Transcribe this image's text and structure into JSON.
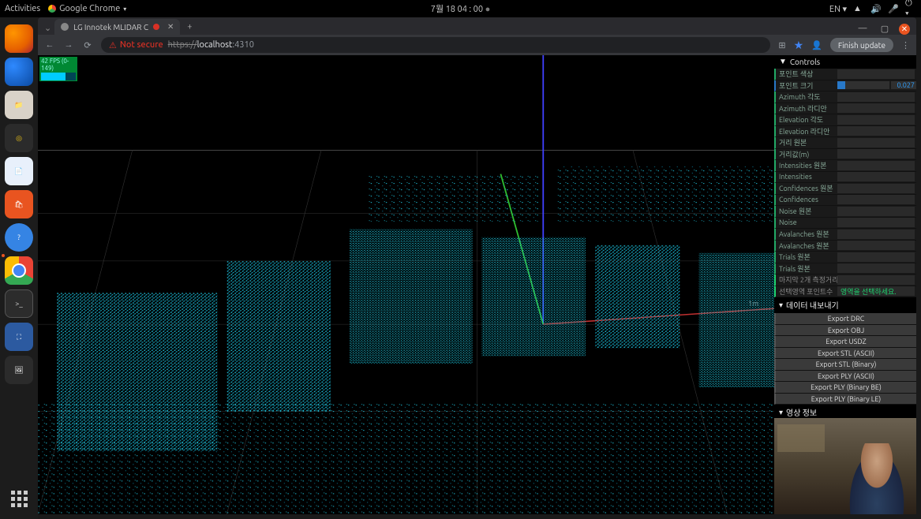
{
  "topbar": {
    "activities": "Activities",
    "app": "Google Chrome",
    "datetime": "7월 18  04 : 00",
    "lang": "EN"
  },
  "chrome": {
    "tab_title": "LG Innotek MLIDAR C",
    "not_secure": "Not secure",
    "https": "https://",
    "host": "localhost",
    "port": ":4310",
    "finish_update": "Finish update"
  },
  "viewer": {
    "fps": "42 FPS (0-149)",
    "axis_label": "1m"
  },
  "gui": {
    "controls_title": "Controls",
    "rows": [
      {
        "label": "포인트 색상",
        "type": "ctrl"
      },
      {
        "label": "포인트 크기",
        "type": "num",
        "val": "0.027",
        "pct": "15%"
      },
      {
        "label": "Azimuth 각도",
        "type": "ctrl"
      },
      {
        "label": "Azimuth 라디안",
        "type": "ctrl"
      },
      {
        "label": "Elevation 각도",
        "type": "ctrl"
      },
      {
        "label": "Elevation 라디안",
        "type": "ctrl"
      },
      {
        "label": "거리 원본",
        "type": "ctrl"
      },
      {
        "label": "거리값(m)",
        "type": "ctrl"
      },
      {
        "label": "Intensities 원본",
        "type": "ctrl"
      },
      {
        "label": "Intensities",
        "type": "ctrl"
      },
      {
        "label": "Confidences 원본",
        "type": "ctrl"
      },
      {
        "label": "Confidences",
        "type": "ctrl"
      },
      {
        "label": "Noise 원본",
        "type": "ctrl"
      },
      {
        "label": "Noise",
        "type": "ctrl"
      },
      {
        "label": "Avalanches 원본",
        "type": "ctrl"
      },
      {
        "label": "Avalanches 원본",
        "type": "ctrl"
      },
      {
        "label": "Trials 원본",
        "type": "ctrl"
      },
      {
        "label": "Trials 원본",
        "type": "ctrl"
      }
    ],
    "summary": [
      {
        "label": "마지막 2개 측정거리",
        "val": ""
      },
      {
        "label": "선택영역 포인트수",
        "val": "영역을 선택하세요."
      }
    ],
    "export_title": "데이터 내보내기",
    "exports": [
      "Export DRC",
      "Export OBJ",
      "Export USDZ",
      "Export STL (ASCII)",
      "Export STL (Binary)",
      "Export PLY (ASCII)",
      "Export PLY (Binary BE)",
      "Export PLY (Binary LE)"
    ],
    "video_title": "영상 정보"
  }
}
